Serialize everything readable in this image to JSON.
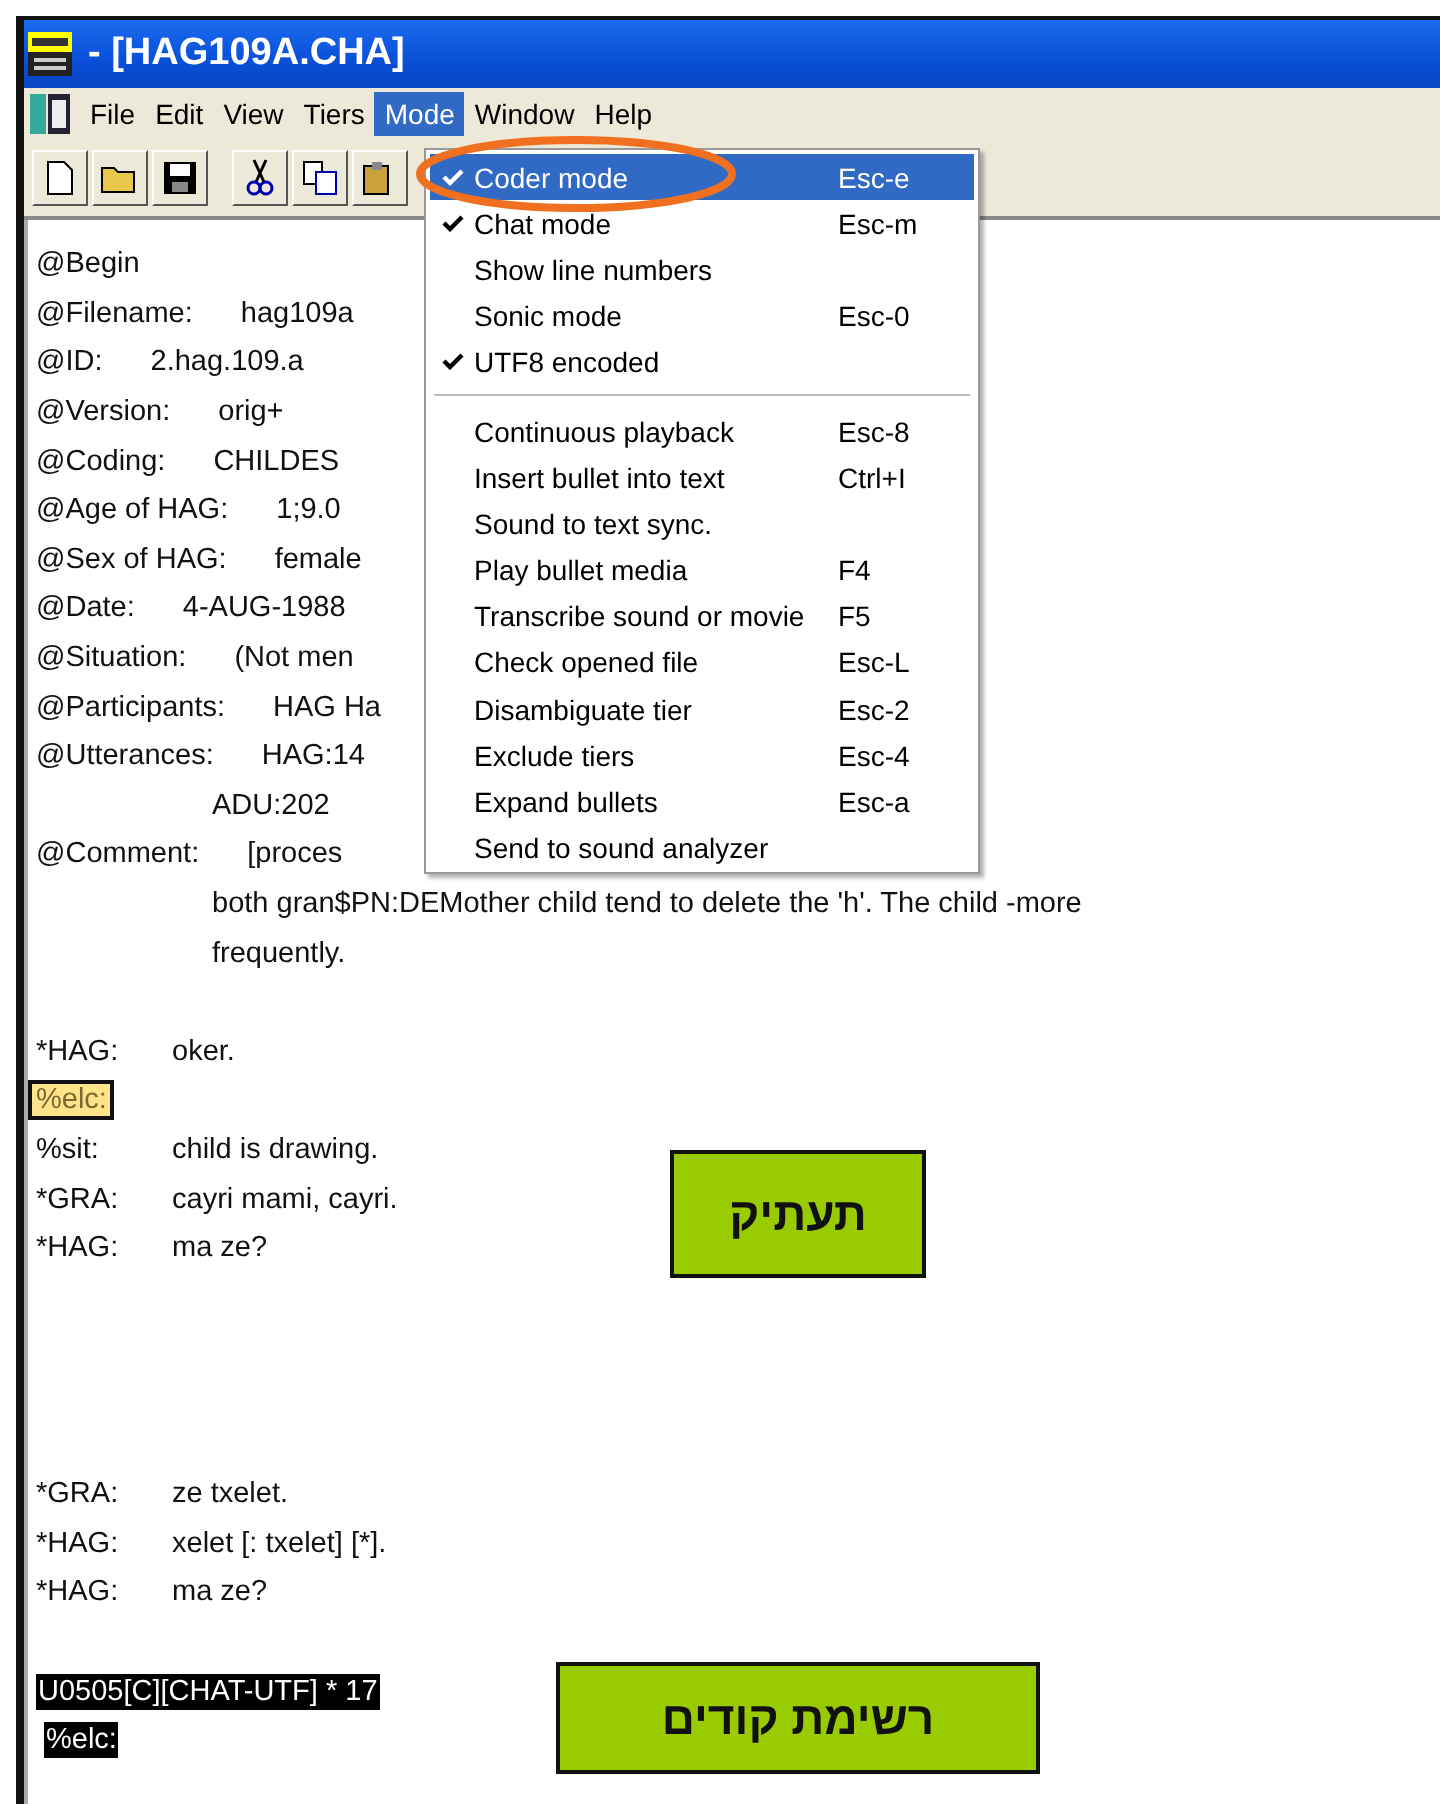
{
  "window": {
    "title": "- [HAG109A.CHA]"
  },
  "menu_bar": [
    {
      "label": "File",
      "selected": false
    },
    {
      "label": "Edit",
      "selected": false
    },
    {
      "label": "View",
      "selected": false
    },
    {
      "label": "Tiers",
      "selected": false
    },
    {
      "label": "Mode",
      "selected": true
    },
    {
      "label": "Window",
      "selected": false
    },
    {
      "label": "Help",
      "selected": false
    }
  ],
  "transcript": {
    "lines": [
      {
        "kind": "header",
        "label": "@Begin"
      },
      {
        "kind": "header",
        "label": "@Filename:",
        "value": "hag109a"
      },
      {
        "kind": "header",
        "label": "@ID:",
        "value": "2.hag.109.a"
      },
      {
        "kind": "header",
        "label": "@Version:",
        "value": "orig+"
      },
      {
        "kind": "header",
        "label": "@Coding:",
        "value": "CHILDES"
      },
      {
        "kind": "header",
        "label": "@Age of HAG:",
        "value": "1;9.0"
      },
      {
        "kind": "header",
        "label": "@Sex of HAG:",
        "value": "female"
      },
      {
        "kind": "header",
        "label": "@Date:",
        "value": "4-AUG-1988"
      },
      {
        "kind": "header",
        "label": "@Situation:",
        "value": "(Not men"
      },
      {
        "kind": "header",
        "label": "@Participants:",
        "value": "HAG Ha"
      },
      {
        "kind": "header",
        "label": "@Utterances:",
        "value": "HAG:14"
      },
      {
        "kind": "continuation",
        "value": "ADU:202"
      },
      {
        "kind": "header",
        "label": "@Comment:",
        "value": "[proces"
      },
      {
        "kind": "continuation",
        "value": "both gran$PN:DEMother child tend to delete the 'h'. The child -more"
      },
      {
        "kind": "continuation",
        "value": "frequently."
      },
      {
        "kind": "blank"
      },
      {
        "kind": "tier",
        "label": "*HAG:",
        "value": "oker."
      },
      {
        "kind": "marked",
        "label": "%elc:"
      },
      {
        "kind": "tier",
        "label": "%sit:",
        "value": "child is drawing."
      },
      {
        "kind": "tier",
        "label": "*GRA:",
        "value": "cayri mami, cayri."
      },
      {
        "kind": "tier",
        "label": "*HAG:",
        "value": "ma ze?"
      },
      {
        "kind": "blank"
      },
      {
        "kind": "blank"
      },
      {
        "kind": "blank"
      },
      {
        "kind": "blank"
      },
      {
        "kind": "tier",
        "label": "*GRA:",
        "value": "ze txelet."
      },
      {
        "kind": "tier",
        "label": "*HAG:",
        "value": "xelet [: txelet] [*]."
      },
      {
        "kind": "tier",
        "label": "*HAG:",
        "value": "ma ze?"
      },
      {
        "kind": "blank"
      },
      {
        "kind": "status",
        "value": "U0505[C][CHAT-UTF] * 17"
      },
      {
        "kind": "status_sub",
        "value": "%elc:"
      }
    ]
  },
  "mode_menu": {
    "items": [
      {
        "kind": "command",
        "label": "Coder mode",
        "shortcut": "Esc-e",
        "checked": true,
        "selected": true
      },
      {
        "kind": "command",
        "label": "Chat mode",
        "shortcut": "Esc-m",
        "checked": true,
        "selected": false
      },
      {
        "kind": "command",
        "label": "Show line numbers",
        "checked": false,
        "selected": false
      },
      {
        "kind": "command",
        "label": "Sonic mode",
        "shortcut": "Esc-0",
        "checked": false,
        "selected": false
      },
      {
        "kind": "command",
        "label": "UTF8 encoded",
        "checked": true,
        "selected": false
      },
      {
        "kind": "separator"
      },
      {
        "kind": "command",
        "label": "Continuous playback",
        "shortcut": "Esc-8",
        "checked": false,
        "selected": false
      },
      {
        "kind": "command",
        "label": "Insert bullet into text",
        "shortcut": "Ctrl+I",
        "checked": false,
        "selected": false
      },
      {
        "kind": "command",
        "label": "Sound to text sync.",
        "checked": false,
        "selected": false
      },
      {
        "kind": "command",
        "label": "Play bullet media",
        "shortcut": "F4",
        "checked": false,
        "selected": false
      },
      {
        "kind": "command",
        "label": "Transcribe sound or movie",
        "shortcut": "F5",
        "checked": false,
        "selected": false
      },
      {
        "kind": "command",
        "label": "Check opened file",
        "shortcut": "Esc-L",
        "checked": false,
        "selected": false
      },
      {
        "kind": "command",
        "label": "Disambiguate tier",
        "shortcut": "Esc-2",
        "checked": false,
        "selected": false
      },
      {
        "kind": "command",
        "label": "Exclude tiers",
        "shortcut": "Esc-4",
        "checked": false,
        "selected": false
      },
      {
        "kind": "command",
        "label": "Expand bullets",
        "shortcut": "Esc-a",
        "checked": false,
        "selected": false
      },
      {
        "kind": "command",
        "label": "Send to sound analyzer",
        "checked": false,
        "selected": false
      }
    ]
  },
  "callouts": [
    {
      "text": "תעתיק"
    },
    {
      "text": "רשימת קודים"
    }
  ]
}
